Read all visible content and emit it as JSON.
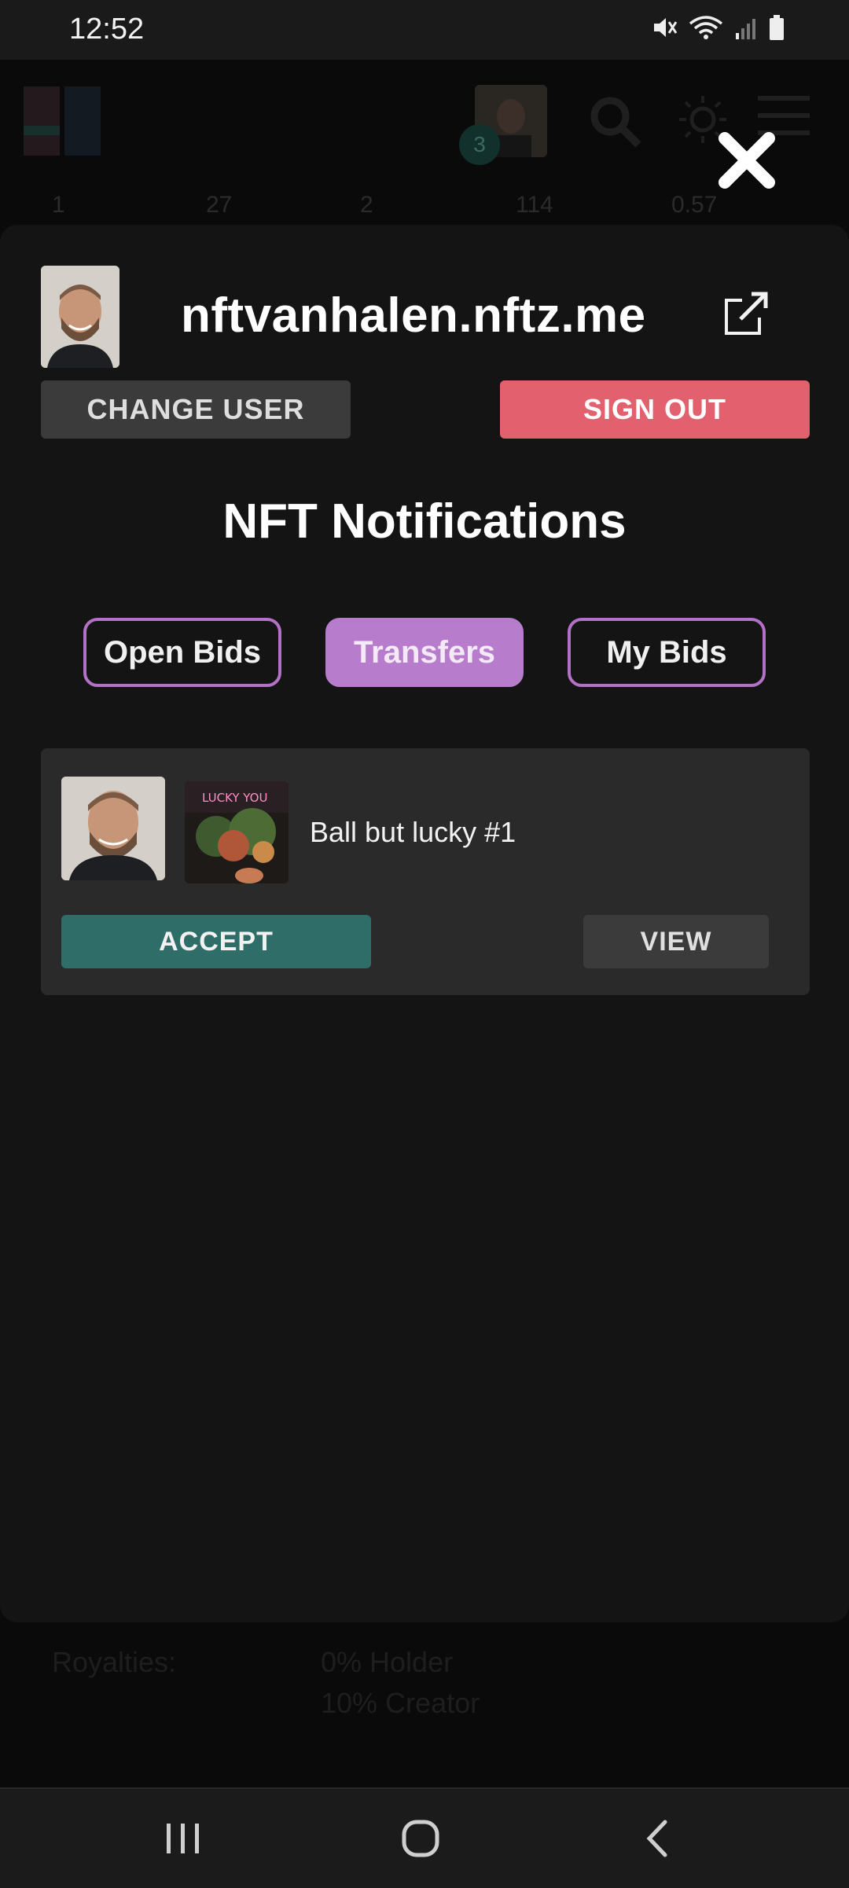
{
  "status_bar": {
    "time": "12:52",
    "icons": [
      "mute-icon",
      "wifi-icon",
      "signal-icon",
      "battery-icon"
    ]
  },
  "background": {
    "stats": [
      "1",
      "27",
      "2",
      "114",
      "0.57"
    ],
    "avatar_badge": "3",
    "royalties_label": "Royalties:",
    "royalties_values": [
      "0% Holder",
      "10% Creator"
    ]
  },
  "modal": {
    "domain": "nftvanhalen.nftz.me",
    "change_user_label": "CHANGE USER",
    "sign_out_label": "SIGN OUT",
    "section_title": "NFT Notifications",
    "tabs": [
      {
        "label": "Open Bids",
        "active": false
      },
      {
        "label": "Transfers",
        "active": true
      },
      {
        "label": "My Bids",
        "active": false
      }
    ],
    "notifications": [
      {
        "title": "Ball but lucky #1",
        "nft_image_text": "LUCKY YOU",
        "accept_label": "ACCEPT",
        "view_label": "VIEW"
      }
    ]
  },
  "colors": {
    "accent_purple": "#b77ccc",
    "sign_out_red": "#e3616f",
    "accept_teal": "#2f6d68",
    "modal_bg": "#141414",
    "card_bg": "#2a2a2a"
  }
}
